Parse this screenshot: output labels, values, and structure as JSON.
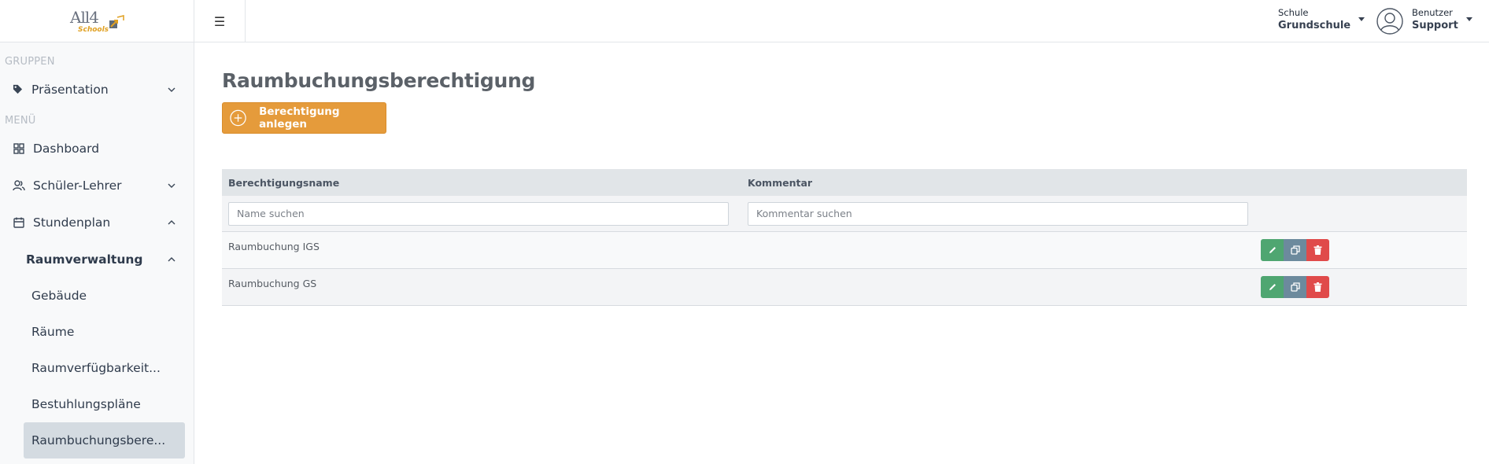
{
  "app": {
    "logo_text": "All4",
    "logo_sub": "Schools"
  },
  "sidebar": {
    "groups_label": "GRUPPEN",
    "menu_label": "MENÜ",
    "presentation": "Präsentation",
    "items": [
      {
        "label": "Dashboard"
      },
      {
        "label": "Schüler-Lehrer"
      },
      {
        "label": "Stundenplan"
      }
    ],
    "room_admin": "Raumverwaltung",
    "sub_items": [
      {
        "label": "Gebäude"
      },
      {
        "label": "Räume"
      },
      {
        "label": "Raumverfügbarkeit..."
      },
      {
        "label": "Bestuhlungspläne"
      },
      {
        "label": "Raumbuchungsbere..."
      }
    ]
  },
  "topbar": {
    "school_label": "Schule",
    "school_value": "Grundschule",
    "user_label": "Benutzer",
    "user_value": "Support"
  },
  "main": {
    "title": "Raumbuchungsberechtigung",
    "add_button": "Berechtigung anlegen",
    "table": {
      "columns": [
        "Berechtigungsname",
        "Kommentar"
      ],
      "filters": {
        "name_placeholder": "Name suchen",
        "comment_placeholder": "Kommentar suchen"
      },
      "rows": [
        {
          "name": "Raumbuchung IGS",
          "comment": ""
        },
        {
          "name": "Raumbuchung GS",
          "comment": ""
        }
      ]
    }
  },
  "colors": {
    "accent": "#e59b3b",
    "edit": "#4fa671",
    "copy": "#6c8a9d",
    "delete": "#e04a4a"
  }
}
